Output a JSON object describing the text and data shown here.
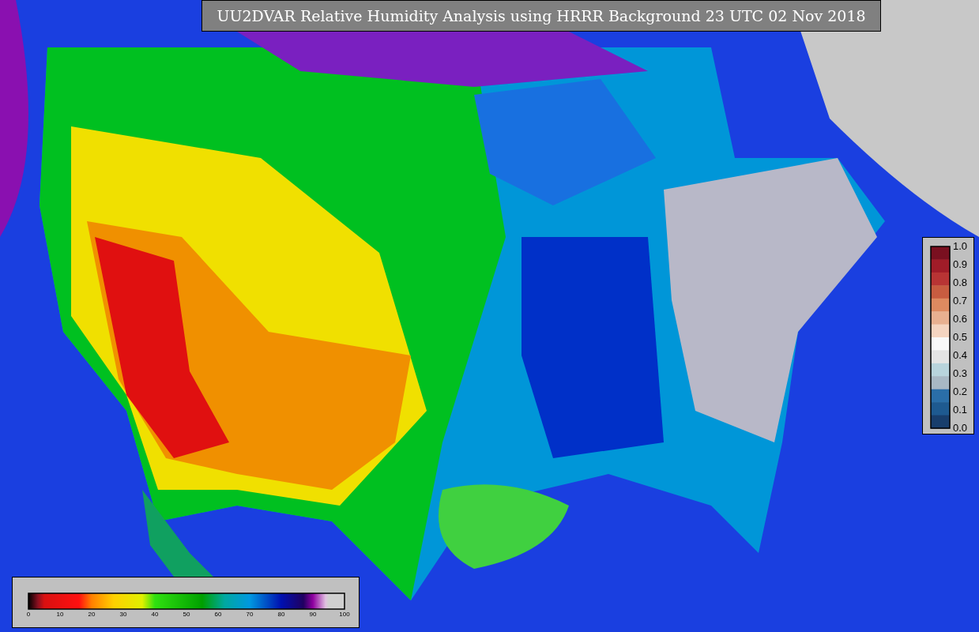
{
  "title": "UU2DVAR Relative Humidity Analysis using HRRR Background 23 UTC 02 Nov 2018",
  "humidity_colorbar": {
    "ticks": [
      "0",
      "10",
      "20",
      "30",
      "40",
      "50",
      "60",
      "70",
      "80",
      "90",
      "100"
    ]
  },
  "station_colorbar": {
    "ticks": [
      "1.0",
      "0.9",
      "0.8",
      "0.7",
      "0.6",
      "0.5",
      "0.4",
      "0.3",
      "0.2",
      "0.1",
      "0.0"
    ]
  }
}
